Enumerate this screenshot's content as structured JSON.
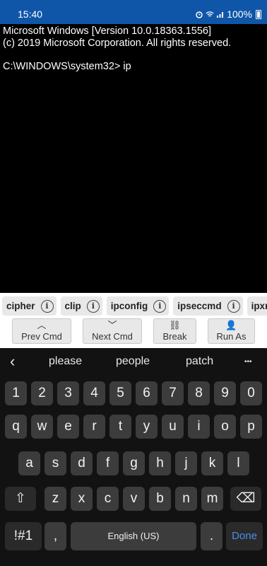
{
  "status": {
    "time": "15:40",
    "battery": "100%"
  },
  "console": {
    "lines": [
      "Microsoft Windows [Version 10.0.18363.1556]",
      "(c) 2019 Microsoft Corporation. All rights reserved.",
      "",
      "C:\\WINDOWS\\system32> ip"
    ]
  },
  "chips": [
    "cipher",
    "clip",
    "ipconfig",
    "ipseccmd",
    "ipxr"
  ],
  "chip_info_glyph": "i",
  "actions": [
    {
      "label": "Prev Cmd",
      "icon": "chevron-up-icon",
      "glyph": "︿"
    },
    {
      "label": "Next Cmd",
      "icon": "chevron-down-icon",
      "glyph": "﹀"
    },
    {
      "label": "Break",
      "icon": "break-link-icon",
      "glyph": "⛓"
    },
    {
      "label": "Run As",
      "icon": "user-icon",
      "glyph": "👤"
    }
  ],
  "keyboard": {
    "back_glyph": "‹",
    "suggestions": [
      "please",
      "people",
      "patch"
    ],
    "more_glyph": "•••",
    "row_numbers": [
      "1",
      "2",
      "3",
      "4",
      "5",
      "6",
      "7",
      "8",
      "9",
      "0"
    ],
    "row1": [
      "q",
      "w",
      "e",
      "r",
      "t",
      "y",
      "u",
      "i",
      "o",
      "p"
    ],
    "row2": [
      "a",
      "s",
      "d",
      "f",
      "g",
      "h",
      "j",
      "k",
      "l"
    ],
    "row3": [
      "z",
      "x",
      "c",
      "v",
      "b",
      "n",
      "m"
    ],
    "shift_glyph": "⇧",
    "backspace_glyph": "⌫",
    "symbols_label": "!#1",
    "comma": ",",
    "space_label": "English (US)",
    "period": ".",
    "done_label": "Done"
  }
}
